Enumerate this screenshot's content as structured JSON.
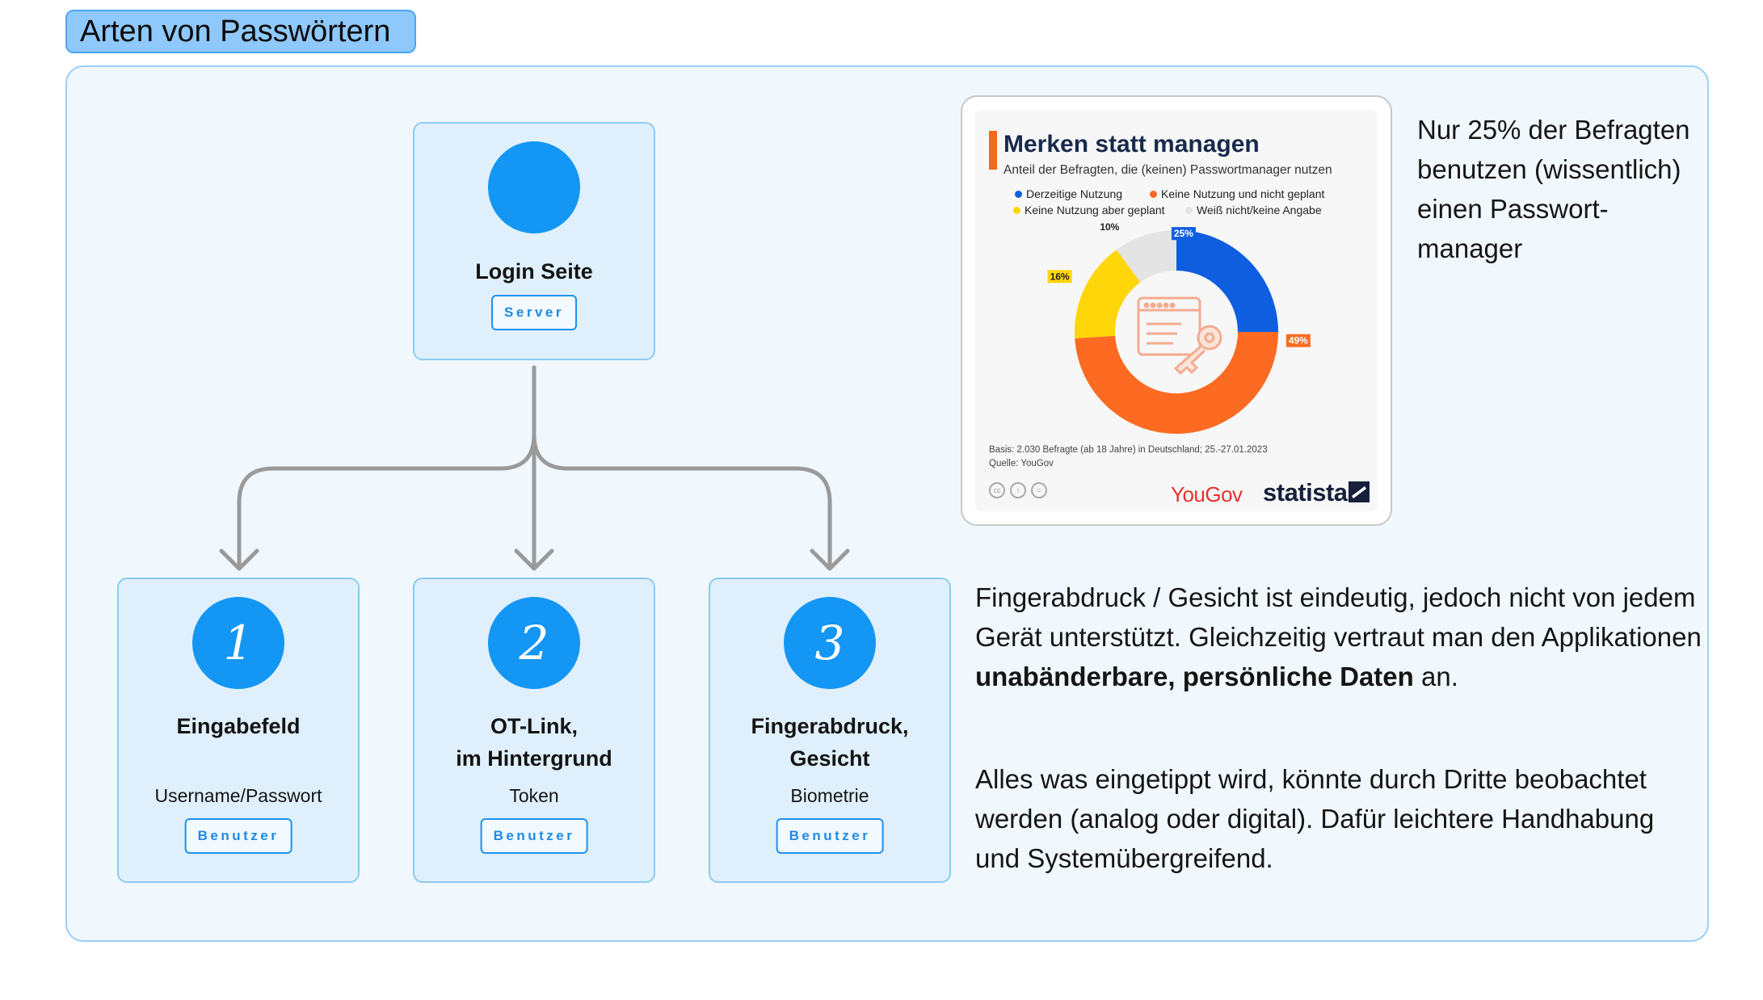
{
  "header": {
    "title": "Arten von Passwörtern"
  },
  "root_node": {
    "title": "Login Seite",
    "tag": "Server"
  },
  "methods": [
    {
      "number": "1",
      "title_line1": "Eingabefeld",
      "title_line2": "",
      "subtitle": "Username/Passwort",
      "tag": "Benutzer"
    },
    {
      "number": "2",
      "title_line1": "OT-Link,",
      "title_line2": "im Hintergrund",
      "subtitle": "Token",
      "tag": "Benutzer"
    },
    {
      "number": "3",
      "title_line1": "Fingerabdruck,",
      "title_line2": "Gesicht",
      "subtitle": "Biometrie",
      "tag": "Benutzer"
    }
  ],
  "infographic": {
    "title": "Merken statt managen",
    "subtitle": "Anteil der Befragten, die (keinen) Passwortmanager nutzen",
    "basis": "Basis: 2.030 Befragte (ab 18 Jahre) in Deutschland; 25.-27.01.2023",
    "source": "Quelle: YouGov",
    "brand_yougov": "YouGov",
    "brand_statista": "statista",
    "center_icon": "key-icon"
  },
  "chart_data": {
    "type": "pie",
    "categories": [
      "Derzeitige Nutzung",
      "Keine Nutzung und nicht geplant",
      "Keine Nutzung aber geplant",
      "Weiß nicht/keine Angabe"
    ],
    "values": [
      25,
      49,
      16,
      10
    ],
    "value_labels": [
      "25%",
      "49%",
      "16%",
      "10%"
    ],
    "colors": [
      "#0f5ee0",
      "#fd6b22",
      "#fed60a",
      "#e4e4e4"
    ],
    "title": "Merken statt managen",
    "subtitle": "Anteil der Befragten, die (keinen) Passwortmanager nutzen",
    "legend": "top",
    "donut": true
  },
  "notes": {
    "manager_note": "Nur 25% der Befragten benutzen (wissentlich) einen Passwort-manager",
    "biometric_note_prefix": "Fingerabdruck / Gesicht ist eindeutig, jedoch nicht von jedem Gerät unterstützt. Gleichzeitig vertraut man den Applikationen",
    "biometric_note_bold": "unabänderbare, persönliche Daten",
    "biometric_note_suffix": "an.",
    "input_note": "Alles was eingetippt wird, könnte durch Dritte beobachtet werden (analog oder digital). Dafür leichtere Handhabung und Systemübergreifend."
  },
  "colors": {
    "accent": "#1496f4",
    "frame_bg": "#f0f8fe",
    "node_bg": "#dff0fc",
    "tab_bg": "#8fc8fb",
    "connector": "#9a9a9a"
  }
}
